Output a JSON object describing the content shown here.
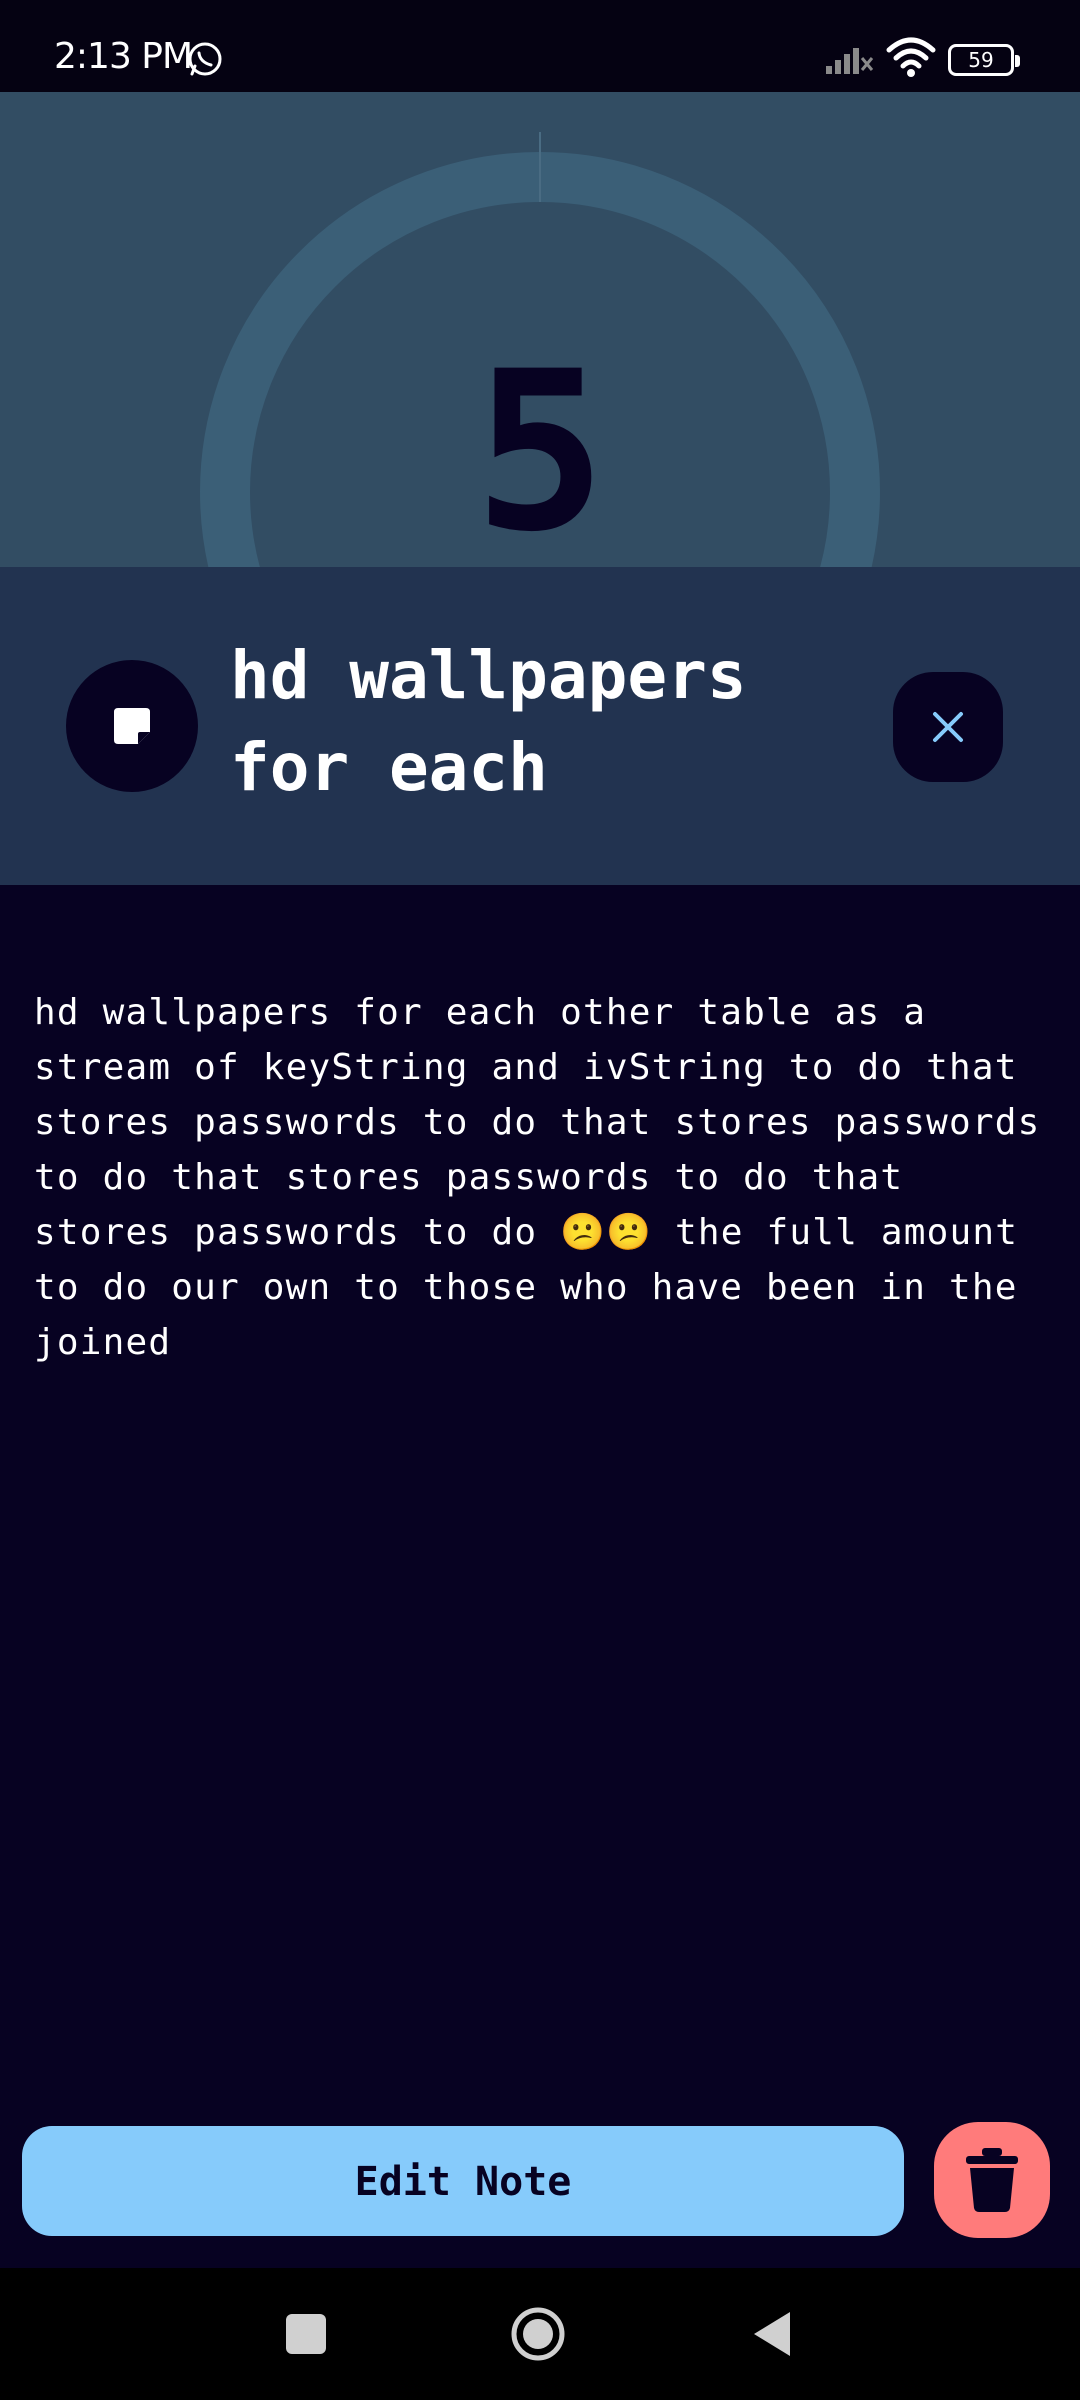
{
  "status_bar": {
    "time": "2:13 PM",
    "battery_level": "59",
    "icons": [
      "whatsapp-icon",
      "signal-icon",
      "wifi-icon",
      "battery-icon"
    ]
  },
  "header": {
    "count": "5"
  },
  "note": {
    "title": "hd wallpapers for each",
    "body": "hd wallpapers for each other table as a stream of keyString and ivString to do that stores passwords to do that stores passwords to do that stores passwords to do that stores passwords to do 😕😕 the full amount to do our own to those who have been in the joined"
  },
  "actions": {
    "edit_label": "Edit Note"
  },
  "colors": {
    "background": "#070222",
    "header": "#324d63",
    "title_band": "#223350",
    "accent_blue": "#86cbfb",
    "delete_red": "#ff7b7b"
  },
  "nav_bar": {
    "icons": [
      "recents-icon",
      "home-icon",
      "back-icon"
    ]
  }
}
